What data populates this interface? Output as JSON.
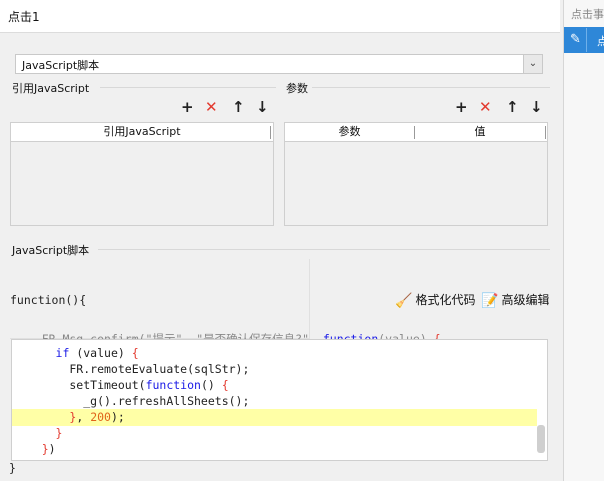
{
  "dialog": {
    "title": "点击1"
  },
  "side_panel": {
    "tab_label": "点击事",
    "other_label": "点"
  },
  "type_select": {
    "value": "JavaScript脚本",
    "arrow": "⌄"
  },
  "ref_js": {
    "legend": "引用JavaScript",
    "column_header": "引用JavaScript"
  },
  "params": {
    "legend": "参数",
    "columns": [
      "参数",
      "值"
    ]
  },
  "toolbar": {
    "add": "+",
    "remove": "✕",
    "up": "↑",
    "down": "↓"
  },
  "script": {
    "legend": "JavaScript脚本",
    "function_header": "function(){",
    "function_footer": "}",
    "format_label": "格式化代码",
    "advanced_label": "高级编辑"
  },
  "code_lines": [
    "    FR.Msg.confirm(\"提示\", \"是否确认保存信息?\", function(value) {",
    "      if (value) {",
    "        FR.remoteEvaluate(sqlStr);",
    "        setTimeout(function() {",
    "          _g().refreshAllSheets();",
    "        }, 200);",
    "      }",
    "    })"
  ],
  "icons": {
    "edit": "pencil-icon",
    "format": "broom-icon",
    "advanced": "edit-box-icon"
  }
}
